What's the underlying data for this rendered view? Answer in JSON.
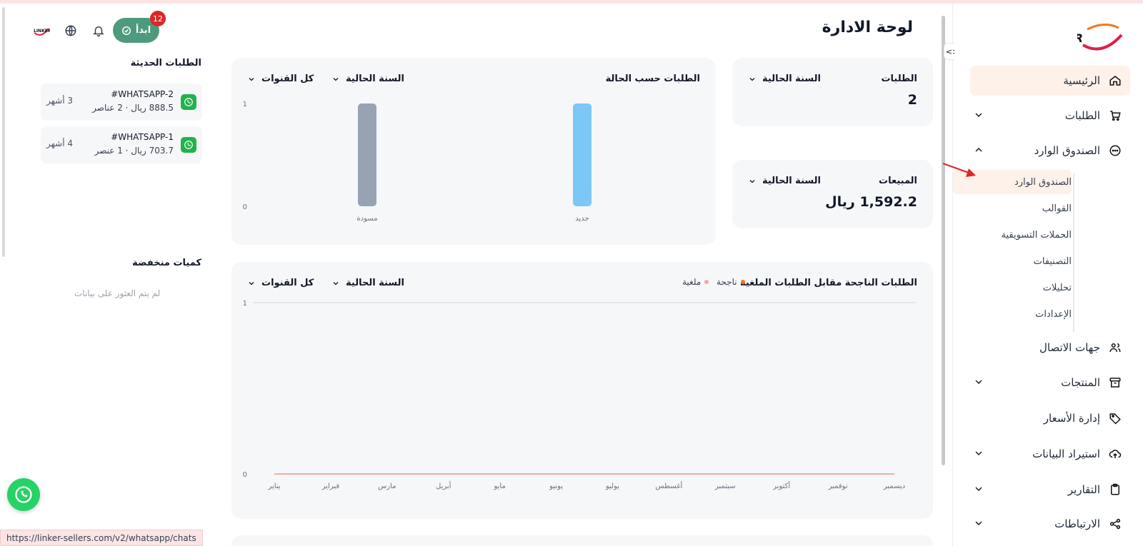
{
  "page": {
    "title": "لوحة الادارة"
  },
  "header": {
    "start_label": "ابدأ",
    "badge_count": "12"
  },
  "sidebar": {
    "items": [
      {
        "label": "الرئيسية",
        "icon": "home-icon"
      },
      {
        "label": "الطلبات",
        "icon": "cart-icon"
      },
      {
        "label": "الصندوق الوارد",
        "icon": "chat-icon"
      },
      {
        "label": "جهات الاتصال",
        "icon": "users-icon"
      },
      {
        "label": "المنتجات",
        "icon": "archive-icon"
      },
      {
        "label": "إدارة الأسعار",
        "icon": "tag-icon"
      },
      {
        "label": "استيراد البيانات",
        "icon": "upload-cloud-icon"
      },
      {
        "label": "التقارير",
        "icon": "clipboard-icon"
      },
      {
        "label": "الارتباطات",
        "icon": "share-icon"
      }
    ],
    "inbox_sub": [
      "الصندوق الوارد",
      "القوالب",
      "الحملات التسويقية",
      "التصنيفات",
      "تحليلات",
      "الإعدادات"
    ]
  },
  "cards": {
    "orders": {
      "title": "الطلبات",
      "period": "السنة الحالية",
      "value": "2"
    },
    "sales": {
      "title": "المبيعات",
      "period": "السنة الحالية",
      "value": "1,592.2 ريال"
    },
    "by_status": {
      "title": "الطلبات حسب الحالة",
      "period": "السنة الحالية",
      "channels": "كل القنوات"
    },
    "success_vs_cancel": {
      "title": "الطلبات الناجحة مقابل الطلبات الملغية",
      "period": "السنة الحالية",
      "channels": "كل القنوات",
      "legend_success": "ناجحة",
      "legend_cancel": "ملغية"
    }
  },
  "recent": {
    "title": "الطلبات الحديثة",
    "orders": [
      {
        "id": "#WHATSAPP-2",
        "summary": "888.5 ريال · 2 عناصر",
        "age": "3 أشهر"
      },
      {
        "id": "#WHATSAPP-1",
        "summary": "703.7 ريال · 1 عنصر",
        "age": "4 أشهر"
      }
    ]
  },
  "low_stock": {
    "title": "كميات منخفضة",
    "empty": "لم يتم العثور على بيانات"
  },
  "status_bar": {
    "url": "https://linker-sellers.com/v2/whatsapp/chats"
  },
  "colors": {
    "accent": "#4e9a7c",
    "active_bg": "#fdf1ea",
    "bar_new": "#7cc7f5",
    "bar_draft": "#97a3b4",
    "success": "#f97316",
    "cancel": "#fca5a5"
  },
  "chart_data": [
    {
      "type": "bar",
      "title": "الطلبات حسب الحالة",
      "categories": [
        "جديد",
        "مسودة"
      ],
      "values": [
        1,
        1
      ],
      "ylim": [
        0,
        1
      ],
      "yticks": [
        "0",
        "1"
      ]
    },
    {
      "type": "line",
      "title": "الطلبات الناجحة مقابل الطلبات الملغية",
      "categories": [
        "ديسمبر",
        "نوفمبر",
        "أكتوبر",
        "سبتمبر",
        "أغسطس",
        "يوليو",
        "يونيو",
        "مايو",
        "أبريل",
        "مارس",
        "فبراير",
        "يناير"
      ],
      "series": [
        {
          "name": "ناجحة",
          "values": [
            0,
            0,
            0,
            0,
            0,
            0,
            0,
            0,
            0,
            0,
            0,
            0
          ]
        },
        {
          "name": "ملغية",
          "values": [
            0,
            0,
            0,
            0,
            0,
            0,
            0,
            0,
            0,
            0,
            0,
            0
          ]
        }
      ],
      "ylim": [
        0,
        1
      ],
      "yticks": [
        "0",
        "1"
      ]
    }
  ]
}
